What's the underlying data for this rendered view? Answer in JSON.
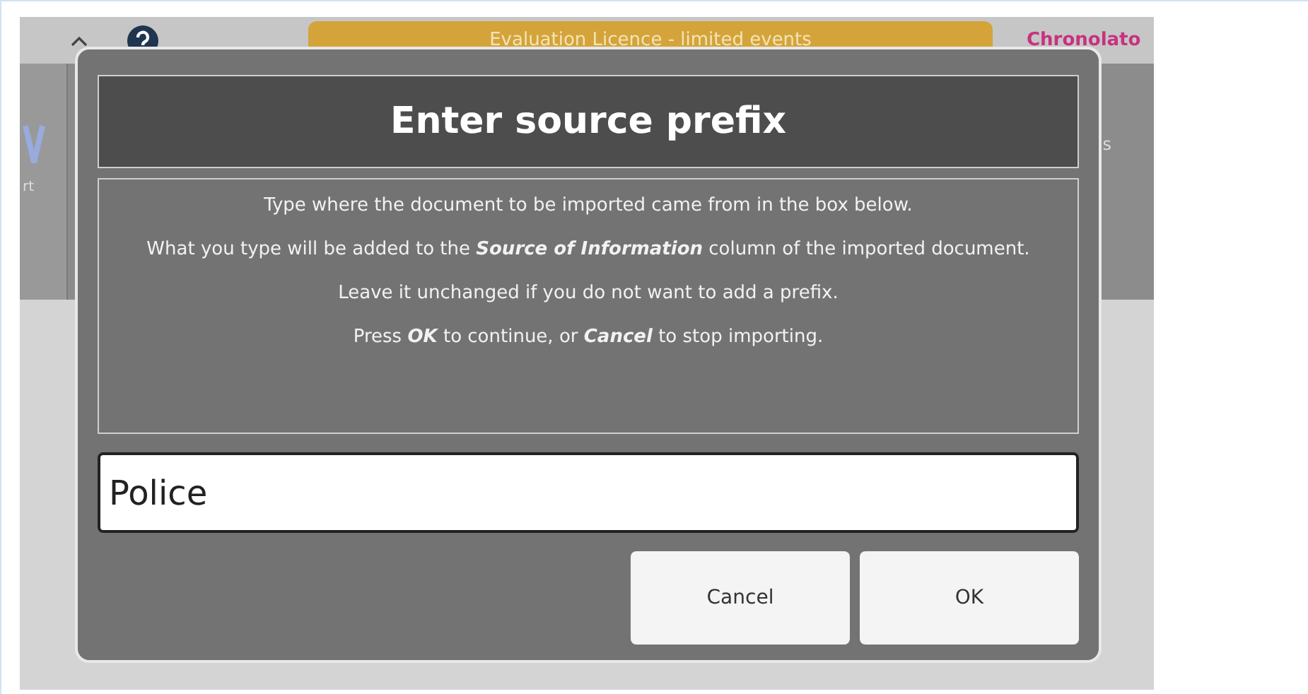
{
  "app": {
    "banner": "Evaluation Licence - limited events",
    "brand": "Chronolato",
    "toolbar_label_left": "rt",
    "toolbar_label_right": "s"
  },
  "dialog": {
    "title": "Enter source prefix",
    "messages": [
      "Type where the document to be imported came from in the box below.",
      "What you type will be added to the **Source of Information** column of the imported document.",
      "Leave it unchanged if you do not want to add a prefix.",
      "Press **OK** to continue, or **Cancel** to stop importing."
    ],
    "input": {
      "value": "Police"
    },
    "buttons": [
      "Cancel",
      "OK"
    ]
  }
}
